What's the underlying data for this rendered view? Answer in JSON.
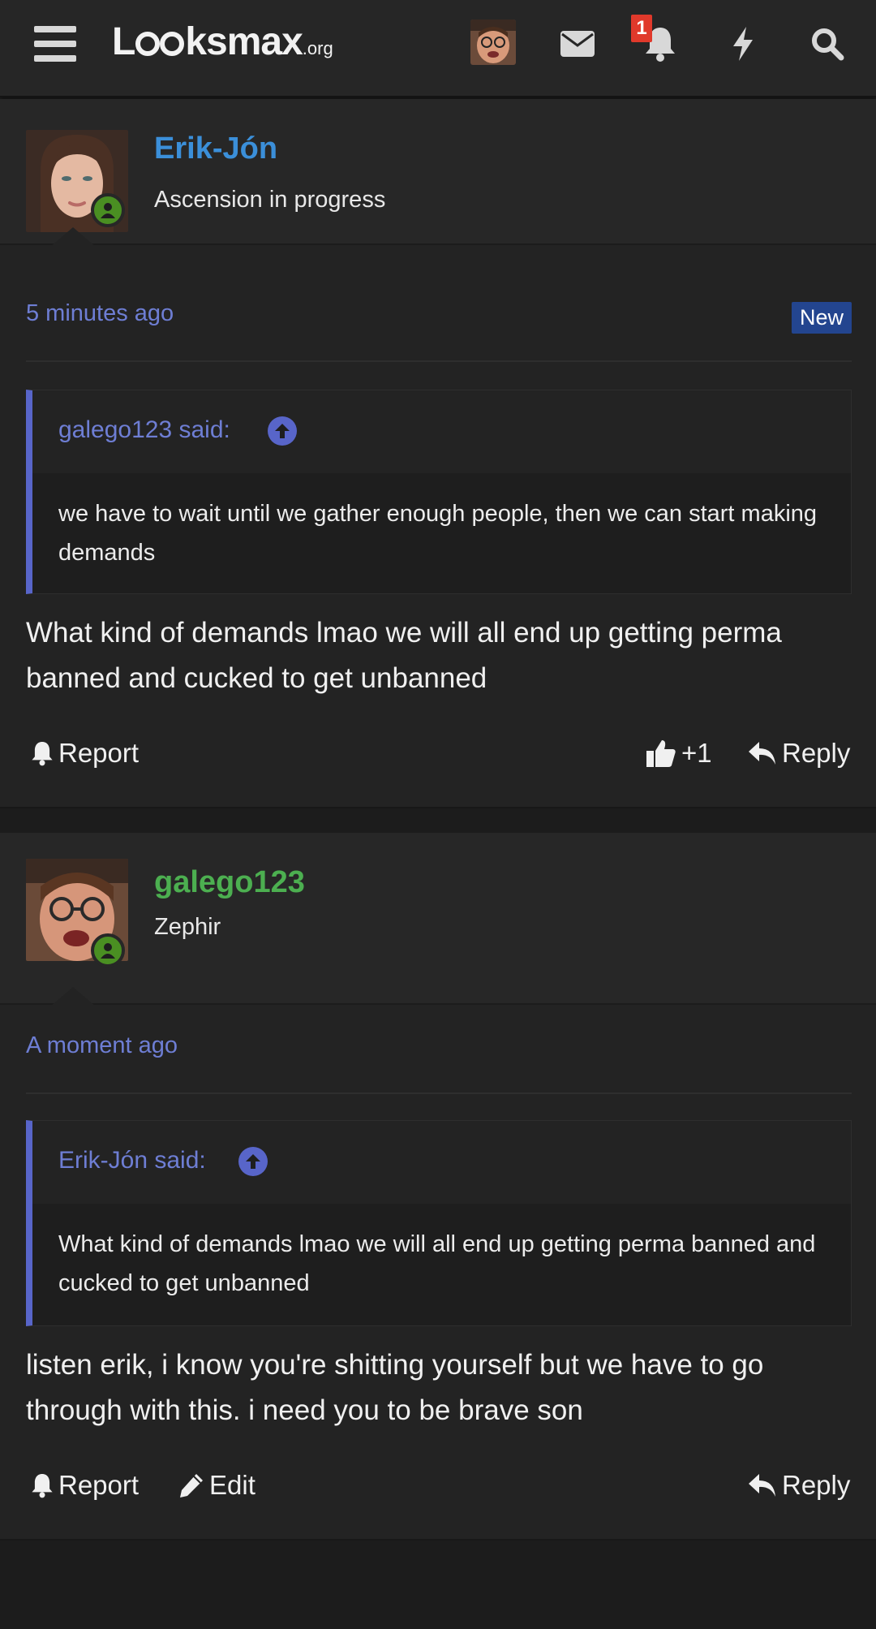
{
  "header": {
    "logo_main": "Lksmax",
    "logo_tld": ".org",
    "notification_count": "1",
    "icons": [
      "menu-icon",
      "user-avatar",
      "mail-icon",
      "bell-icon",
      "lightning-icon",
      "search-icon"
    ]
  },
  "posts": [
    {
      "username": "Erik-Jón",
      "username_color": "#3b8fd9",
      "user_title": "Ascension in progress",
      "time": "5 minutes ago",
      "badge": "New",
      "quote": {
        "author": "galego123 said:",
        "text": "we have to wait until we gather enough people, then we can start making demands"
      },
      "message": "What kind of demands lmao we will all end up getting perma banned and cucked to get unbanned",
      "actions": {
        "report": "Report",
        "like": "+1",
        "reply": "Reply"
      }
    },
    {
      "username": "galego123",
      "username_color": "#4caf50",
      "user_title": "Zephir",
      "time": "A moment ago",
      "quote": {
        "author": "Erik-Jón said:",
        "text": "What kind of demands lmao we will all end up getting perma banned and cucked to get unbanned"
      },
      "message": "listen erik, i know you're shitting yourself but we have to go through with this. i need you to be brave son",
      "actions": {
        "report": "Report",
        "edit": "Edit",
        "reply": "Reply"
      }
    }
  ],
  "colors": {
    "link": "#6e7ed4",
    "quote_bar": "#5865c9",
    "online": "#4a8f22",
    "badge": "#23458f"
  }
}
